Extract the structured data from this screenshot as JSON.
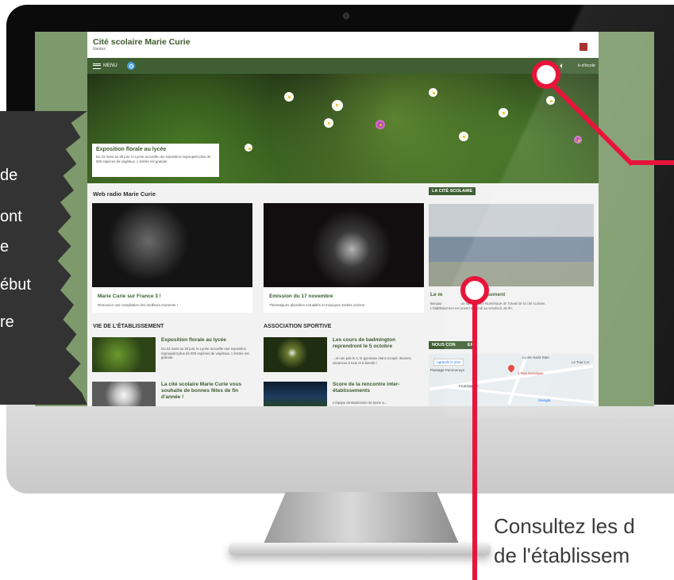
{
  "site": {
    "title": "Cité scolaire Marie Curie",
    "subtitle": "Nantes",
    "menu_label": "MENU",
    "nav_right_label": "k-d'école",
    "nav_left_fragment": "s"
  },
  "hero": {
    "title": "Exposition florale au lycée",
    "text": "Du 22 mars au 28 juin, le Lycée accueille une exposition regroupant plus de 500 espèces de végétaux. L'entrée est gratuite."
  },
  "webradio": {
    "heading": "Web radio Marie Curie",
    "cards": [
      {
        "title": "Marie Curie sur France 3 !",
        "text": "Retrouvez une compilation des meilleurs moments !"
      },
      {
        "title": "Emission du 17 novembre",
        "text": "Thématiques abordées Actualités et musiques Sorties cinéma"
      }
    ]
  },
  "vie": {
    "heading": "VIE DE L'ÉTABLISSEMENT",
    "items": [
      {
        "title": "Exposition florale au lycée",
        "text": "Du 22 mars au 28 juin, le Lycée accueille une exposition regroupant plus de 500 espèces de végétaux. L'entrée est gratuite."
      },
      {
        "title": "La cité scolaire Marie Curie vous souhaite de bonnes fêtes de fin d'année !",
        "text": ""
      }
    ]
  },
  "sport": {
    "heading": "ASSOCIATION SPORTIVE",
    "items": [
      {
        "title": "Les cours de badmington reprendront le 5 octobre",
        "text": "...et non pas le 4, le gymnase étant occupé. Bonnes vacances à tous et à bientôt !"
      },
      {
        "title": "Score de la rencontre inter-établissements",
        "text": "L'équipe de Badminton du lycée a..."
      }
    ]
  },
  "sidebar": {
    "cite_label": "LA CITÉ SCOLAIRE",
    "cite_title": "Le m                       ablissement",
    "cite_text": "Bonjour                    ue sur l'Espace Numérique de Travail de la cité scolaire.                        L'établissement est ouvert du lundi au vendredi, de 8h.",
    "contact_label": "NOUS CON          ER",
    "map": {
      "top_label": "Lycée Saint Stan",
      "button": "Agrandir le plan",
      "street1": "Passage Pommeraye",
      "street2": "Fruit Nantes",
      "address": "1 Rue Kervégan",
      "other": "Le Tour LU",
      "brand": "Google"
    }
  },
  "overlay": {
    "badge_lines": [
      "de",
      "ont",
      "e",
      "ébut",
      "re"
    ],
    "caption_line1": "Consultez les d",
    "caption_line2": "de l'établissem"
  },
  "colors": {
    "accent_green": "#3f5f33",
    "title_green": "#3d5a2e",
    "screen_bg": "#7e9a6c",
    "marker_red": "#e8153a",
    "badge_bg": "#333333"
  }
}
